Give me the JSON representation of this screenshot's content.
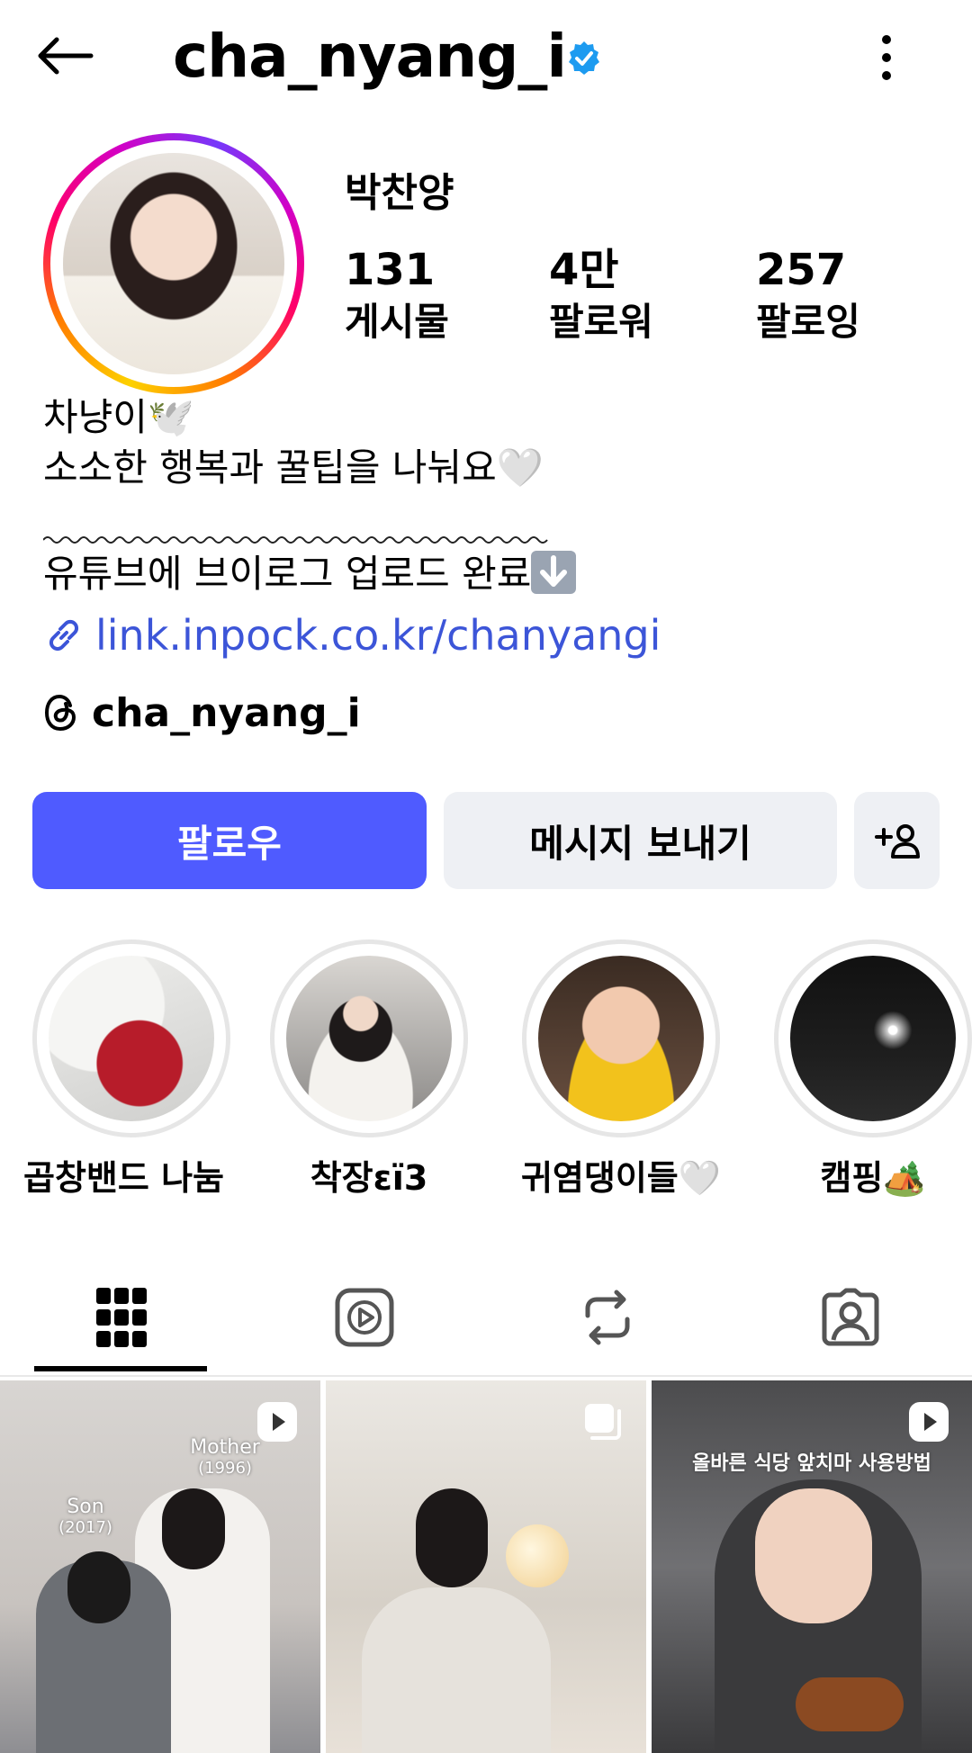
{
  "header": {
    "username": "cha_nyang_i"
  },
  "profile": {
    "display_name": "박찬양",
    "stats": [
      {
        "value": "131",
        "label": "게시물"
      },
      {
        "value": "4만",
        "label": "팔로워"
      },
      {
        "value": "257",
        "label": "팔로잉"
      }
    ],
    "bio_line1": "차냥이🕊️",
    "bio_line2": "소소한 행복과 꿀팁을 나눠요🤍",
    "bio_line3": "유튜브에 브이로그 업로드 완료",
    "link": "link.inpock.co.kr/chanyangi",
    "threads_handle": "cha_nyang_i"
  },
  "buttons": {
    "follow": "팔로우",
    "message": "메시지 보내기"
  },
  "highlights": [
    {
      "label": "곱창밴드 나눔 ..."
    },
    {
      "label": "착장ɛï3"
    },
    {
      "label": "귀염댕이들🤍"
    },
    {
      "label": "캠핑🏕️"
    }
  ],
  "posts": [
    {
      "type": "reel",
      "caption_a": "Mother",
      "caption_a2": "(1996)",
      "caption_b": "Son",
      "caption_b2": "(2017)"
    },
    {
      "type": "carousel"
    },
    {
      "type": "reel",
      "caption": "올바른 식당 앞치마 사용방법"
    }
  ],
  "colors": {
    "follow_button": "#4f5bff",
    "secondary_button": "#eef0f4",
    "link": "#3c55d8",
    "verified": "#1d9bf0"
  }
}
